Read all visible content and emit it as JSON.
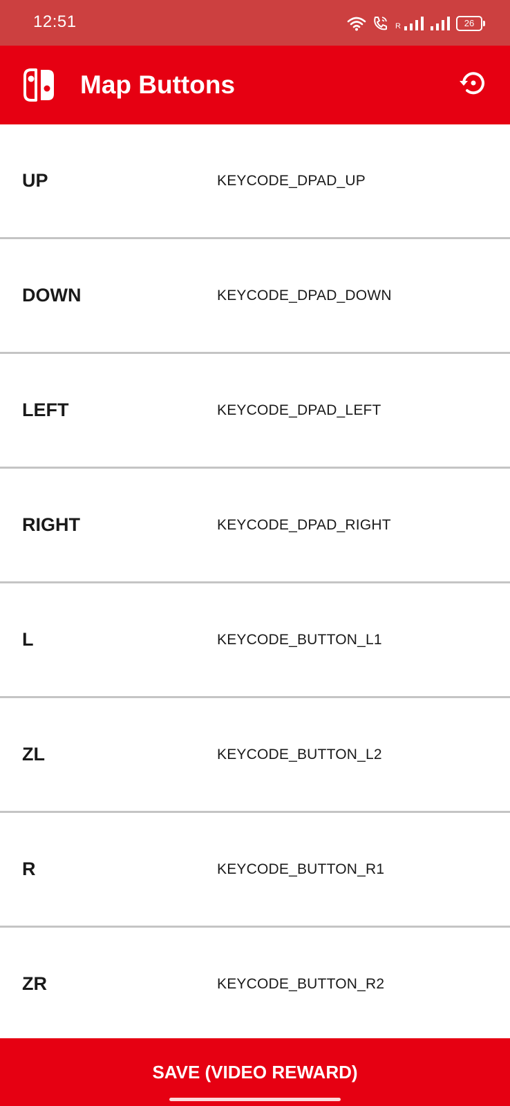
{
  "status_bar": {
    "time": "12:51",
    "roaming": "R",
    "battery": "26"
  },
  "app_bar": {
    "title": "Map Buttons",
    "logo_icon": "switch-console-icon",
    "reset_icon": "restore-icon"
  },
  "mappings": [
    {
      "label": "UP",
      "value": "KEYCODE_DPAD_UP"
    },
    {
      "label": "DOWN",
      "value": "KEYCODE_DPAD_DOWN"
    },
    {
      "label": "LEFT",
      "value": "KEYCODE_DPAD_LEFT"
    },
    {
      "label": "RIGHT",
      "value": "KEYCODE_DPAD_RIGHT"
    },
    {
      "label": "L",
      "value": "KEYCODE_BUTTON_L1"
    },
    {
      "label": "ZL",
      "value": "KEYCODE_BUTTON_L2"
    },
    {
      "label": "R",
      "value": "KEYCODE_BUTTON_R1"
    },
    {
      "label": "ZR",
      "value": "KEYCODE_BUTTON_R2"
    }
  ],
  "save_button": {
    "label": "SAVE (VIDEO REWARD)"
  },
  "colors": {
    "brand_red": "#e60012",
    "status_bar": "#cc4040",
    "divider": "#c4c4c4"
  }
}
